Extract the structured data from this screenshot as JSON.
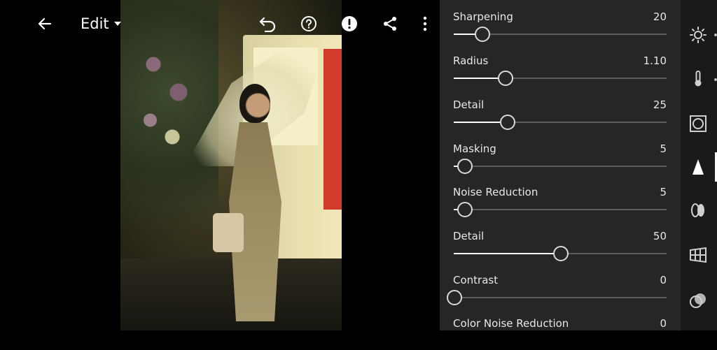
{
  "topbar": {
    "edit_label": "Edit"
  },
  "sliders": [
    {
      "label": "Sharpening",
      "value": "20",
      "fraction": 0.13
    },
    {
      "label": "Radius",
      "value": "1.10",
      "fraction": 0.24
    },
    {
      "label": "Detail",
      "value": "25",
      "fraction": 0.25
    },
    {
      "label": "Masking",
      "value": "5",
      "fraction": 0.05
    },
    {
      "label": "Noise Reduction",
      "value": "5",
      "fraction": 0.05
    },
    {
      "label": "Detail",
      "value": "50",
      "fraction": 0.5
    },
    {
      "label": "Contrast",
      "value": "0",
      "fraction": 0.0
    },
    {
      "label": "Color Noise Reduction",
      "value": "0",
      "fraction": 0.0
    }
  ],
  "rail": {
    "icons": [
      "light-icon",
      "color-icon",
      "effects-icon",
      "detail-icon",
      "optics-icon",
      "geometry-icon",
      "mixer-icon"
    ],
    "selected": "detail-icon"
  },
  "colors": {
    "panel_bg": "#262626",
    "rail_bg": "#1a1a1a",
    "track": "#5c5c5c",
    "fill": "#ffffff"
  }
}
